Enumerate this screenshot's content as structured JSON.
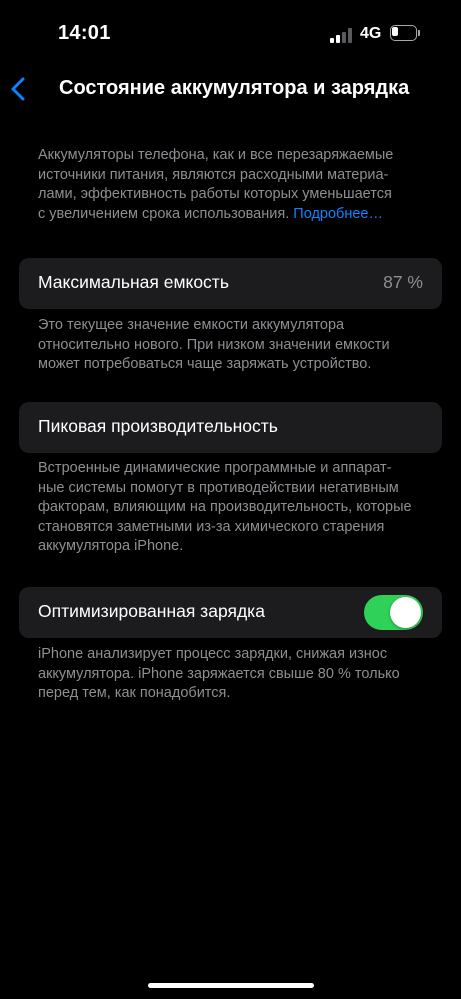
{
  "status_bar": {
    "time": "14:01",
    "network": "4G",
    "battery_level": 0.2
  },
  "nav": {
    "back_icon": "chevron-left-icon",
    "title": "Состояние аккумулятора и зарядка"
  },
  "intro": {
    "lines": [
      "Аккумуляторы телефона, как и все перезаряжаемые",
      "источники питания, являются расходными материа-",
      "лами, эффективность работы которых уменьшается",
      "с увеличением срока использования."
    ],
    "link": "Подробнее…"
  },
  "max_capacity": {
    "label": "Максимальная емкость",
    "value": "87 %",
    "description": [
      "Это текущее значение емкости аккумулятора",
      "относительно нового. При низком значении емкости",
      "может потребоваться чаще заряжать устройство."
    ]
  },
  "peak_performance": {
    "label": "Пиковая производительность",
    "description": [
      "Встроенные динамические программные и аппарат-",
      "ные системы помогут в противодействии негативным",
      "факторам, влияющим на производительность, которые",
      "становятся заметными из-за химического старения",
      "аккумулятора iPhone."
    ]
  },
  "optimized_charging": {
    "label": "Оптимизированная зарядка",
    "enabled": true,
    "description": [
      "iPhone анализирует процесс зарядки, снижая износ",
      "аккумулятора. iPhone заряжается свыше 80 % только",
      "перед тем, как понадобится."
    ]
  },
  "colors": {
    "accent": "#0a84ff",
    "toggle_on": "#30d158",
    "cell_bg": "#1c1c1e",
    "secondary_text": "#8e8e93"
  }
}
